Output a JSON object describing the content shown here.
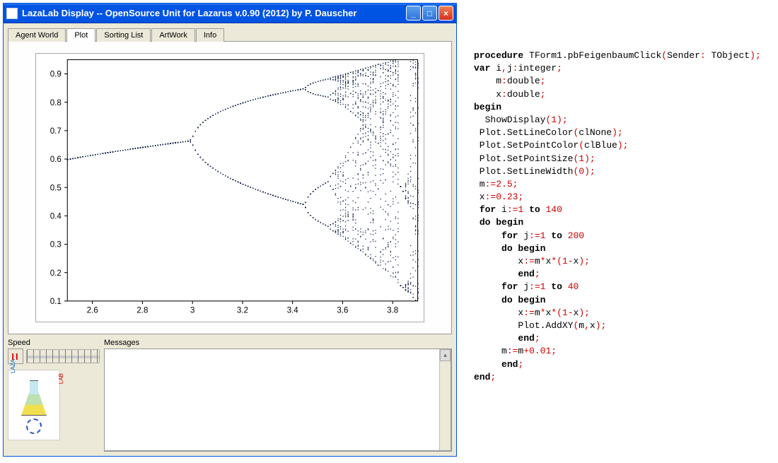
{
  "window": {
    "title": "LazaLab Display -- OpenSource Unit for Lazarus  v.0.90 (2012) by P. Dauscher"
  },
  "tabs": [
    "Agent World",
    "Plot",
    "Sorting List",
    "ArtWork",
    "Info"
  ],
  "active_tab": "Plot",
  "bottom": {
    "speed_label": "Speed",
    "messages_label": "Messages",
    "pause_glyph": "II"
  },
  "logo": {
    "left": "LAZA",
    "right": "LAB"
  },
  "chart_data": {
    "type": "scatter",
    "title": "",
    "xlabel": "",
    "ylabel": "",
    "xlim": [
      2.5,
      3.9
    ],
    "ylim": [
      0.1,
      0.95
    ],
    "xticks": [
      2.6,
      2.8,
      3.0,
      3.2,
      3.4,
      3.6,
      3.8
    ],
    "yticks": [
      0.1,
      0.2,
      0.3,
      0.4,
      0.5,
      0.6,
      0.7,
      0.8,
      0.9
    ],
    "description": "Feigenbaum bifurcation diagram of logistic map x := m*x*(1-x), m from 2.5 to 3.9 step 0.01, last 40 iterates plotted after 200 warm-up.",
    "generator": {
      "m_start": 2.5,
      "m_end": 3.9,
      "m_step": 0.01,
      "x0": 0.23,
      "warmup_iters": 200,
      "plot_iters": 40
    }
  },
  "code": {
    "lines": [
      [
        [
          "kw",
          "procedure"
        ],
        [
          "id",
          " TForm1.pbFeigenbaumClick"
        ],
        [
          "pn",
          "("
        ],
        [
          "id",
          "Sender"
        ],
        [
          "pn",
          ":"
        ],
        [
          "id",
          " TObject"
        ],
        [
          "pn",
          ")"
        ],
        [
          "pn",
          ";"
        ]
      ],
      [
        [
          "kw",
          "var"
        ],
        [
          "id",
          " i"
        ],
        [
          "pn",
          ","
        ],
        [
          "id",
          "j"
        ],
        [
          "pn",
          ":"
        ],
        [
          "id",
          "integer"
        ],
        [
          "pn",
          ";"
        ]
      ],
      [
        [
          "id",
          "    m"
        ],
        [
          "pn",
          ":"
        ],
        [
          "id",
          "double"
        ],
        [
          "pn",
          ";"
        ]
      ],
      [
        [
          "id",
          "    x"
        ],
        [
          "pn",
          ":"
        ],
        [
          "id",
          "double"
        ],
        [
          "pn",
          ";"
        ]
      ],
      [
        [
          "kw",
          "begin"
        ]
      ],
      [
        [
          "id",
          "  ShowDisplay"
        ],
        [
          "pn",
          "("
        ],
        [
          "num",
          "1"
        ],
        [
          "pn",
          ")"
        ],
        [
          "pn",
          ";"
        ]
      ],
      [
        [
          "id",
          " Plot.SetLineColor"
        ],
        [
          "pn",
          "("
        ],
        [
          "id",
          "clNone"
        ],
        [
          "pn",
          ")"
        ],
        [
          "pn",
          ";"
        ]
      ],
      [
        [
          "id",
          " Plot.SetPointColor"
        ],
        [
          "pn",
          "("
        ],
        [
          "id",
          "clBlue"
        ],
        [
          "pn",
          ")"
        ],
        [
          "pn",
          ";"
        ]
      ],
      [
        [
          "id",
          " Plot.SetPointSize"
        ],
        [
          "pn",
          "("
        ],
        [
          "num",
          "1"
        ],
        [
          "pn",
          ")"
        ],
        [
          "pn",
          ";"
        ]
      ],
      [
        [
          "id",
          " Plot.SetLineWidth"
        ],
        [
          "pn",
          "("
        ],
        [
          "num",
          "0"
        ],
        [
          "pn",
          ")"
        ],
        [
          "pn",
          ";"
        ]
      ],
      [
        [
          "id",
          " m"
        ],
        [
          "op",
          ":="
        ],
        [
          "num",
          "2.5"
        ],
        [
          "pn",
          ";"
        ]
      ],
      [
        [
          "id",
          " x"
        ],
        [
          "op",
          ":="
        ],
        [
          "num",
          "0.23"
        ],
        [
          "pn",
          ";"
        ]
      ],
      [
        [
          "id",
          " "
        ],
        [
          "kw",
          "for"
        ],
        [
          "id",
          " i"
        ],
        [
          "op",
          ":="
        ],
        [
          "num",
          "1"
        ],
        [
          "id",
          " "
        ],
        [
          "kw",
          "to"
        ],
        [
          "id",
          " "
        ],
        [
          "num",
          "140"
        ]
      ],
      [
        [
          "id",
          " "
        ],
        [
          "kw",
          "do begin"
        ]
      ],
      [
        [
          "id",
          "     "
        ],
        [
          "kw",
          "for"
        ],
        [
          "id",
          " j"
        ],
        [
          "op",
          ":="
        ],
        [
          "num",
          "1"
        ],
        [
          "id",
          " "
        ],
        [
          "kw",
          "to"
        ],
        [
          "id",
          " "
        ],
        [
          "num",
          "200"
        ]
      ],
      [
        [
          "id",
          "     "
        ],
        [
          "kw",
          "do begin"
        ]
      ],
      [
        [
          "id",
          "        x"
        ],
        [
          "op",
          ":="
        ],
        [
          "id",
          "m"
        ],
        [
          "op",
          "*"
        ],
        [
          "id",
          "x"
        ],
        [
          "op",
          "*"
        ],
        [
          "pn",
          "("
        ],
        [
          "num",
          "1"
        ],
        [
          "op",
          "-"
        ],
        [
          "id",
          "x"
        ],
        [
          "pn",
          ")"
        ],
        [
          "pn",
          ";"
        ]
      ],
      [
        [
          "id",
          "        "
        ],
        [
          "kw",
          "end"
        ],
        [
          "pn",
          ";"
        ]
      ],
      [
        [
          "id",
          "     "
        ],
        [
          "kw",
          "for"
        ],
        [
          "id",
          " j"
        ],
        [
          "op",
          ":="
        ],
        [
          "num",
          "1"
        ],
        [
          "id",
          " "
        ],
        [
          "kw",
          "to"
        ],
        [
          "id",
          " "
        ],
        [
          "num",
          "40"
        ]
      ],
      [
        [
          "id",
          "     "
        ],
        [
          "kw",
          "do begin"
        ]
      ],
      [
        [
          "id",
          "        x"
        ],
        [
          "op",
          ":="
        ],
        [
          "id",
          "m"
        ],
        [
          "op",
          "*"
        ],
        [
          "id",
          "x"
        ],
        [
          "op",
          "*"
        ],
        [
          "pn",
          "("
        ],
        [
          "num",
          "1"
        ],
        [
          "op",
          "-"
        ],
        [
          "id",
          "x"
        ],
        [
          "pn",
          ")"
        ],
        [
          "pn",
          ";"
        ]
      ],
      [
        [
          "id",
          "        Plot.AddXY"
        ],
        [
          "pn",
          "("
        ],
        [
          "id",
          "m"
        ],
        [
          "pn",
          ","
        ],
        [
          "id",
          "x"
        ],
        [
          "pn",
          ")"
        ],
        [
          "pn",
          ";"
        ]
      ],
      [
        [
          "id",
          "        "
        ],
        [
          "kw",
          "end"
        ],
        [
          "pn",
          ";"
        ]
      ],
      [
        [
          "id",
          "     m"
        ],
        [
          "op",
          ":="
        ],
        [
          "id",
          "m"
        ],
        [
          "op",
          "+"
        ],
        [
          "num",
          "0.01"
        ],
        [
          "pn",
          ";"
        ]
      ],
      [
        [
          "id",
          "     "
        ],
        [
          "kw",
          "end"
        ],
        [
          "pn",
          ";"
        ]
      ],
      [
        [
          "kw",
          "end"
        ],
        [
          "pn",
          ";"
        ]
      ]
    ]
  }
}
